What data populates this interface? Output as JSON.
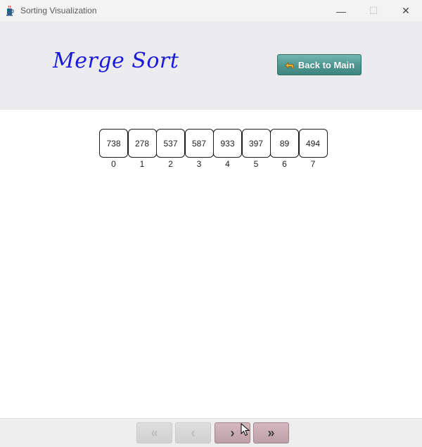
{
  "window": {
    "title": "Sorting Visualization",
    "app_icon": "java-cup-icon",
    "controls": {
      "minimize": "—",
      "maximize": "☐",
      "close": "✕"
    }
  },
  "header": {
    "title": "Merge Sort",
    "title_color": "#1a1adc",
    "back_button": {
      "label": "Back to Main",
      "icon": "back-arrow-icon"
    }
  },
  "array": {
    "values": [
      "738",
      "278",
      "537",
      "587",
      "933",
      "397",
      "89",
      "494"
    ],
    "indices": [
      "0",
      "1",
      "2",
      "3",
      "4",
      "5",
      "6",
      "7"
    ]
  },
  "navigation": {
    "first": {
      "label": "«",
      "enabled": false
    },
    "prev": {
      "label": "‹",
      "enabled": false
    },
    "next": {
      "label": "›",
      "enabled": true
    },
    "last": {
      "label": "»",
      "enabled": true
    },
    "enabled_color": "#c7aab0",
    "disabled_color": "#d8d8d8"
  }
}
